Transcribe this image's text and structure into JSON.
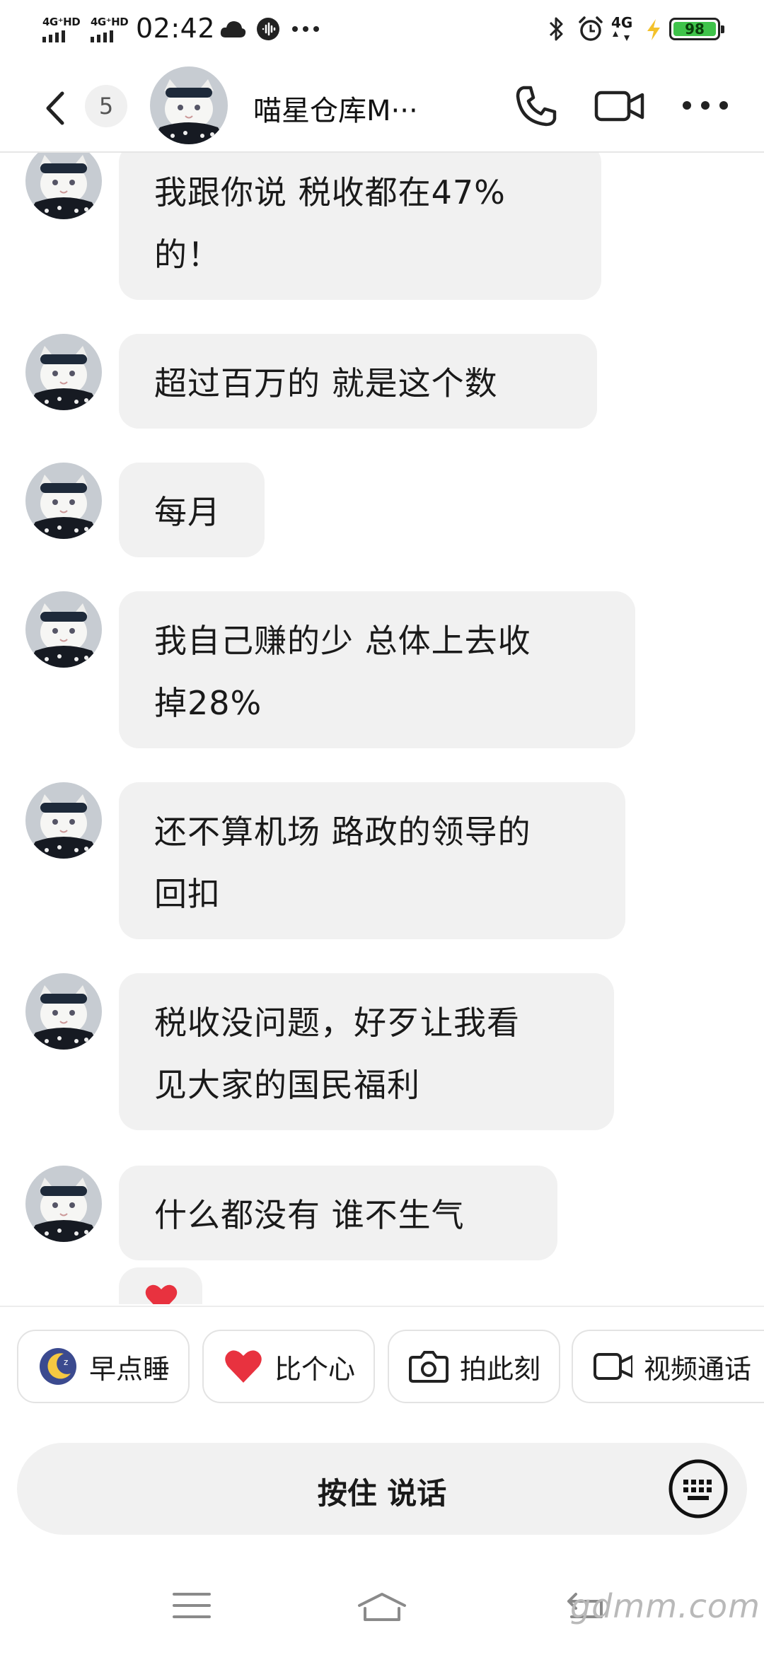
{
  "status_bar": {
    "sim1_label": "4G⁺HD",
    "sim2_label": "4G⁺HD",
    "time": "02:42",
    "network_label": "4G",
    "battery_level": "98",
    "icons": [
      "signal-icon",
      "signal-icon",
      "cloud-icon",
      "voice-message-icon",
      "more-dots-icon",
      "bluetooth-icon",
      "alarm-icon",
      "network-4g-icon",
      "charging-icon",
      "battery-icon"
    ],
    "battery_color": "#3fc34a"
  },
  "header": {
    "unread_count": "5",
    "title": "喵星仓库M···",
    "icons": [
      "back-icon",
      "phone-icon",
      "video-call-icon",
      "more-icon"
    ]
  },
  "messages": [
    {
      "lines": [
        "我跟你说  税收都在47%",
        "的！"
      ]
    },
    {
      "lines": [
        "超过百万的  就是这个数"
      ]
    },
    {
      "lines": [
        "每月"
      ]
    },
    {
      "lines": [
        "我自己赚的少  总体上去收",
        "掉28%"
      ]
    },
    {
      "lines": [
        "还不算机场 路政的领导的",
        "回扣"
      ]
    },
    {
      "lines": [
        "税收没问题，好歹让我看",
        "见大家的国民福利"
      ]
    },
    {
      "lines": [
        "什么都没有  谁不生气"
      ]
    }
  ],
  "reaction": {
    "icon": "heart-icon"
  },
  "quick_replies": [
    {
      "label": "早点睡",
      "icon": "moon-sleep-icon"
    },
    {
      "label": "比个心",
      "icon": "heart-icon"
    },
    {
      "label": "拍此刻",
      "icon": "camera-icon"
    },
    {
      "label": "视频通话",
      "icon": "video-call-icon"
    }
  ],
  "input": {
    "hold_to_talk": "按住 说话",
    "icon": "keyboard-icon"
  },
  "nav": {
    "icons": [
      "menu-icon",
      "home-icon",
      "back-nav-icon"
    ]
  },
  "watermark": "gdmm.com",
  "colors": {
    "bubble": "#f1f1f1",
    "heart": "#e8323f",
    "battery": "#3fc34a"
  }
}
